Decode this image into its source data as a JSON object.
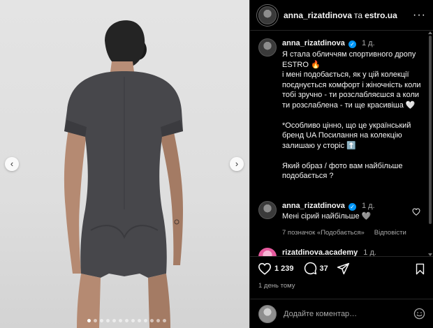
{
  "photo": {
    "carousel_dots": 13,
    "active_dot": 0,
    "prev_glyph": "‹",
    "next_glyph": "›",
    "background_color": "#e0e0e0",
    "garment_color": "#47474b"
  },
  "header": {
    "author": "anna_rizatdinova",
    "conjunction": "та",
    "collaborator": "estro.ua",
    "more_glyph": "···"
  },
  "post": {
    "author": "anna_rizatdinova",
    "verified": true,
    "time": "1 д.",
    "caption": "Я стала обличчям спортивного дропу ESTRO 🔥\nі мені подобається, як у цій колекції поєднується комфорт і жіночність коли тобі зручно - ти розслабляєшся а коли ти розслаблена - ти ще красивіша 🤍\n\n*Особливо цінно, що це український бренд UA Посилання на колекцію залишаю у сторіс ⬆️\n\nЯкий образ / фото вам найбільше подобається ?"
  },
  "comments": [
    {
      "author": "anna_rizatdinova",
      "verified": true,
      "time": "1 д.",
      "text": "Мені сірий найбільше 🩶",
      "likes": "7 позначок «Подобається»",
      "reply": "Відповісти"
    },
    {
      "author": "rizatdinova.academy",
      "time": "1 д."
    }
  ],
  "actions": {
    "likes_count": "1 239",
    "comments_count": "37",
    "like_icon": "heart-icon",
    "comment_icon": "comment-bubble-icon",
    "share_icon": "paper-plane-icon",
    "save_icon": "bookmark-icon"
  },
  "posted_time": "1 день тому",
  "add_comment": {
    "placeholder": "Додайте коментар…",
    "emoji_icon": "smiley-icon"
  },
  "colors": {
    "panel_bg": "#000000",
    "text": "#f5f5f5",
    "muted": "#a8a8a8",
    "verified": "#0095f6",
    "divider": "#262626"
  }
}
